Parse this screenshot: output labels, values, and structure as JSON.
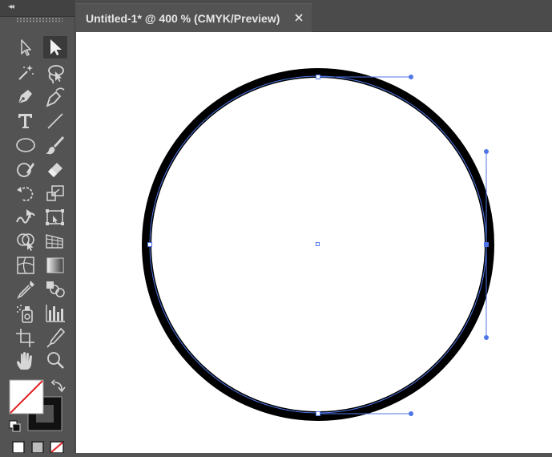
{
  "document": {
    "tab_title": "Untitled-1* @ 400 % (CMYK/Preview)",
    "close_icon": "close-icon"
  },
  "toolbar": {
    "collapse_label": "◂◂",
    "tools": [
      {
        "name": "selection-tool",
        "icon": "arrow-outline-icon",
        "selected": false
      },
      {
        "name": "direct-selection-tool",
        "icon": "arrow-filled-icon",
        "selected": true
      },
      {
        "name": "magic-wand-tool",
        "icon": "magic-wand-icon",
        "selected": false
      },
      {
        "name": "lasso-tool",
        "icon": "lasso-icon",
        "selected": false
      },
      {
        "name": "pen-tool",
        "icon": "pen-icon",
        "selected": false
      },
      {
        "name": "curvature-tool",
        "icon": "curvature-pen-icon",
        "selected": false
      },
      {
        "name": "type-tool",
        "icon": "type-icon",
        "selected": false
      },
      {
        "name": "line-segment-tool",
        "icon": "line-icon",
        "selected": false
      },
      {
        "name": "ellipse-tool",
        "icon": "ellipse-icon",
        "selected": false
      },
      {
        "name": "paintbrush-tool",
        "icon": "paintbrush-icon",
        "selected": false
      },
      {
        "name": "shaper-tool",
        "icon": "shaper-icon",
        "selected": false
      },
      {
        "name": "eraser-tool",
        "icon": "eraser-icon",
        "selected": false
      },
      {
        "name": "rotate-tool",
        "icon": "rotate-icon",
        "selected": false
      },
      {
        "name": "scale-tool",
        "icon": "scale-icon",
        "selected": false
      },
      {
        "name": "warp-tool",
        "icon": "warp-icon",
        "selected": false
      },
      {
        "name": "free-transform-tool",
        "icon": "free-transform-icon",
        "selected": false
      },
      {
        "name": "shape-builder-tool",
        "icon": "shape-builder-icon",
        "selected": false
      },
      {
        "name": "perspective-grid-tool",
        "icon": "perspective-grid-icon",
        "selected": false
      },
      {
        "name": "mesh-tool",
        "icon": "mesh-icon",
        "selected": false
      },
      {
        "name": "gradient-tool",
        "icon": "gradient-icon",
        "selected": false
      },
      {
        "name": "eyedropper-tool",
        "icon": "eyedropper-icon",
        "selected": false
      },
      {
        "name": "blend-tool",
        "icon": "blend-icon",
        "selected": false
      },
      {
        "name": "symbol-sprayer-tool",
        "icon": "symbol-sprayer-icon",
        "selected": false
      },
      {
        "name": "column-graph-tool",
        "icon": "column-graph-icon",
        "selected": false
      },
      {
        "name": "artboard-tool",
        "icon": "artboard-icon",
        "selected": false
      },
      {
        "name": "slice-tool",
        "icon": "slice-icon",
        "selected": false
      },
      {
        "name": "hand-tool",
        "icon": "hand-icon",
        "selected": false
      },
      {
        "name": "zoom-tool",
        "icon": "zoom-icon",
        "selected": false
      }
    ],
    "fill": "none",
    "stroke": "#000000"
  },
  "artwork": {
    "shape": "circle",
    "stroke_color": "#000000",
    "selection_color": "#4f76e6",
    "canvas_color": "#ffffff"
  }
}
